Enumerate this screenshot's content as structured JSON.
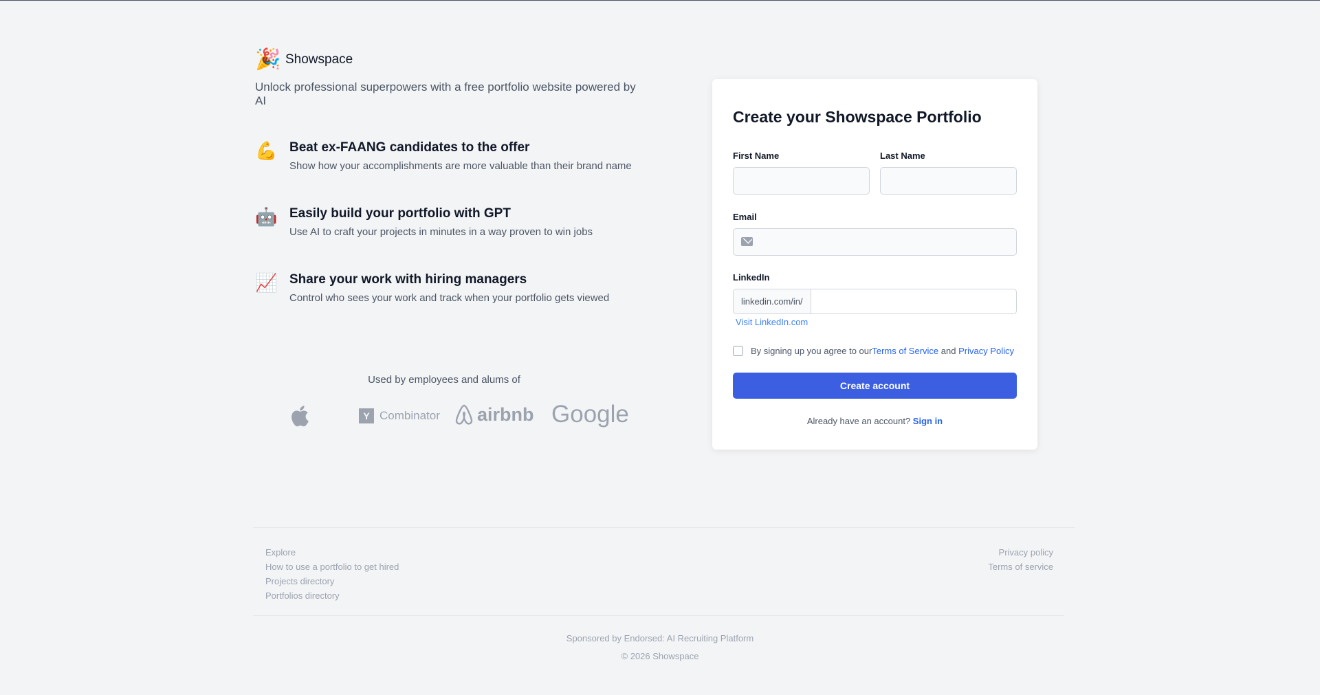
{
  "brand": {
    "name": "Showspace",
    "logo_emoji": "🎉"
  },
  "tagline": "Unlock professional superpowers with a free portfolio website powered by AI",
  "features": [
    {
      "emoji": "💪",
      "title": "Beat ex-FAANG candidates to the offer",
      "desc": "Show how your accomplishments are more valuable than their brand name"
    },
    {
      "emoji": "🤖",
      "title": "Easily build your portfolio with GPT",
      "desc": "Use AI to craft your projects in minutes in a way proven to win jobs"
    },
    {
      "emoji": "📈",
      "title": "Share your work with hiring managers",
      "desc": "Control who sees your work and track when your portfolio gets viewed"
    }
  ],
  "used_by": {
    "label": "Used by employees and alums of",
    "yc_text": "Combinator",
    "yc_letter": "Y",
    "airbnb_text": "airbnb",
    "google_text": "Google"
  },
  "form": {
    "title": "Create your Showspace Portfolio",
    "first_name_label": "First Name",
    "last_name_label": "Last Name",
    "email_label": "Email",
    "linkedin_label": "LinkedIn",
    "linkedin_prefix": "linkedin.com/in/",
    "visit_linkedin": "Visit LinkedIn.com",
    "terms_text": "By signing up you agree to our ",
    "terms_link": "Terms of Service",
    "terms_and": " and ",
    "privacy_link": "Privacy Policy",
    "submit_label": "Create account",
    "signin_text": "Already have an account? ",
    "signin_link": "Sign in"
  },
  "footer": {
    "left_links": [
      "Explore",
      "How to use a portfolio to get hired",
      "Projects directory",
      "Portfolios directory"
    ],
    "right_links": [
      "Privacy policy",
      "Terms of service"
    ],
    "sponsor": "Sponsored by Endorsed: AI Recruiting Platform",
    "copyright": "© 2026 Showspace"
  }
}
